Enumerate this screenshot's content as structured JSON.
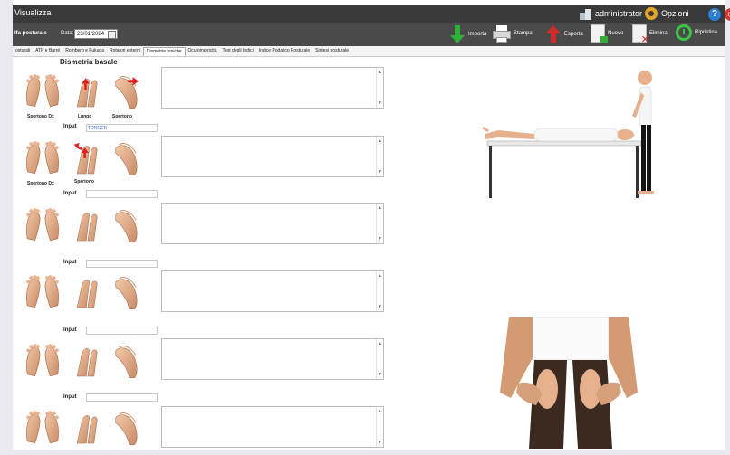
{
  "window": {
    "title": "Visualizza"
  },
  "header": {
    "user": "administrator",
    "options_label": "Opzioni",
    "help_glyph": "?",
    "power_glyph": "⏻"
  },
  "toolbar": {
    "section": "Ifa posturale",
    "date_label": "Data:",
    "date_value": "23/01/2024",
    "buttons": [
      "Importa",
      "Stampa",
      "Esporta",
      "Nuovo",
      "Elimina",
      "Ripristina"
    ],
    "icons": [
      "arrow-down-green-icon",
      "printer-icon",
      "arrow-up-red-icon",
      "new-document-icon",
      "delete-document-icon",
      "restore-clock-icon"
    ]
  },
  "tabs": [
    "osturali",
    "ATP e Barré",
    "Romberg e Fukuda",
    "Rotatori esterni",
    "Dismetrie toniche",
    "Oculomotricità",
    "Test degli Indici",
    "Indice Podalico Posturale",
    "Sintesi posturale"
  ],
  "active_tab": "Dismetrie toniche",
  "main": {
    "heading": "Dismetria basale",
    "rows": [
      {
        "labels": [
          "Spertono Dx",
          "Lungo",
          "Spertono"
        ],
        "input_label": "Input",
        "input_value": "TONGER"
      },
      {
        "labels": [
          "Spertono Dx",
          "",
          "Spertono"
        ],
        "input_label": "Input",
        "input_value": ""
      },
      {
        "labels": [
          "",
          "",
          ""
        ],
        "input_label": "",
        "input_value": ""
      },
      {
        "labels": [
          "",
          "",
          ""
        ],
        "input_label": "Input",
        "input_value": ""
      },
      {
        "labels": [
          "",
          "",
          ""
        ],
        "input_label": "Input",
        "input_value": ""
      },
      {
        "labels": [
          "",
          "",
          ""
        ],
        "input_label": "Input",
        "input_value": ""
      },
      {
        "labels": [
          "",
          "",
          ""
        ],
        "input_label": "",
        "input_value": ""
      }
    ]
  },
  "colors": {
    "titlebar": "#3a3a3a",
    "toolbar": "#4a4a4a",
    "accent_green": "#2fae3a",
    "accent_red": "#d42a2a",
    "skin": "#e7b08c",
    "link_blue": "#3a66c4"
  }
}
